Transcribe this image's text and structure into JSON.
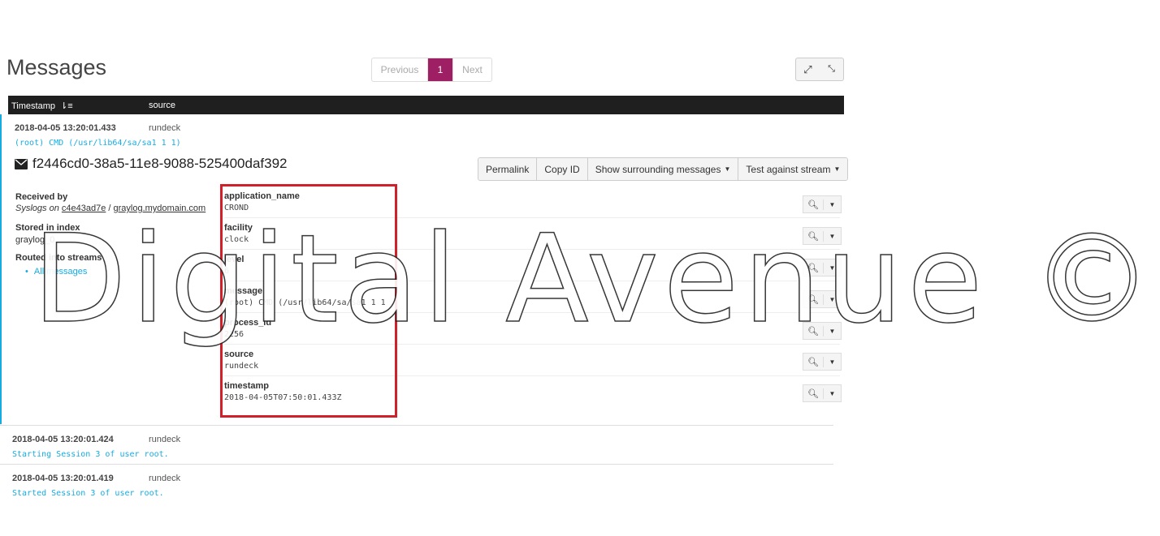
{
  "page": {
    "title": "Messages"
  },
  "pagination": {
    "previous": "Previous",
    "current": "1",
    "next": "Next"
  },
  "table": {
    "col_timestamp": "Timestamp",
    "col_source": "source"
  },
  "expanded_message": {
    "timestamp": "2018-04-05 13:20:01.433",
    "source": "rundeck",
    "message_line": "(root) CMD (/usr/lib64/sa/sa1 1 1)",
    "id": "f2446cd0-38a5-11e8-9088-525400daf392",
    "actions": {
      "permalink": "Permalink",
      "copy_id": "Copy ID",
      "show_surrounding": "Show surrounding messages",
      "test_stream": "Test against stream"
    },
    "meta": {
      "received_by_label": "Received by",
      "received_by_value_prefix": "Syslogs on",
      "received_by_node": "c4e43ad7e",
      "received_by_host": "graylog.mydomain.com",
      "stored_label": "Stored in index",
      "stored_value": "graylog_0",
      "routed_label": "Routed into streams",
      "stream": "All messages"
    },
    "fields": [
      {
        "name": "application_name",
        "value": "CROND"
      },
      {
        "name": "facility",
        "value": "clock"
      },
      {
        "name": "level",
        "value": "6"
      },
      {
        "name": "message",
        "value": "(root) CMD (/usr/lib64/sa/sa1 1 1)"
      },
      {
        "name": "process_id",
        "value": "2256"
      },
      {
        "name": "source",
        "value": "rundeck"
      },
      {
        "name": "timestamp",
        "value": "2018-04-05T07:50:01.433Z"
      }
    ]
  },
  "rows": [
    {
      "timestamp": "2018-04-05 13:20:01.424",
      "source": "rundeck",
      "message": "Starting Session 3 of user root."
    },
    {
      "timestamp": "2018-04-05 13:20:01.419",
      "source": "rundeck",
      "message": "Started Session 3 of user root."
    }
  ],
  "watermark": "Digital Avenue ©",
  "colors": {
    "accent": "#9e1f63",
    "link": "#16ace3",
    "highlight": "#d0202a",
    "header": "#1f1f1f"
  },
  "icons": [
    "expand-icon",
    "compress-icon",
    "sort-icon",
    "envelope-icon",
    "zoom-icon",
    "caret-down-icon"
  ]
}
